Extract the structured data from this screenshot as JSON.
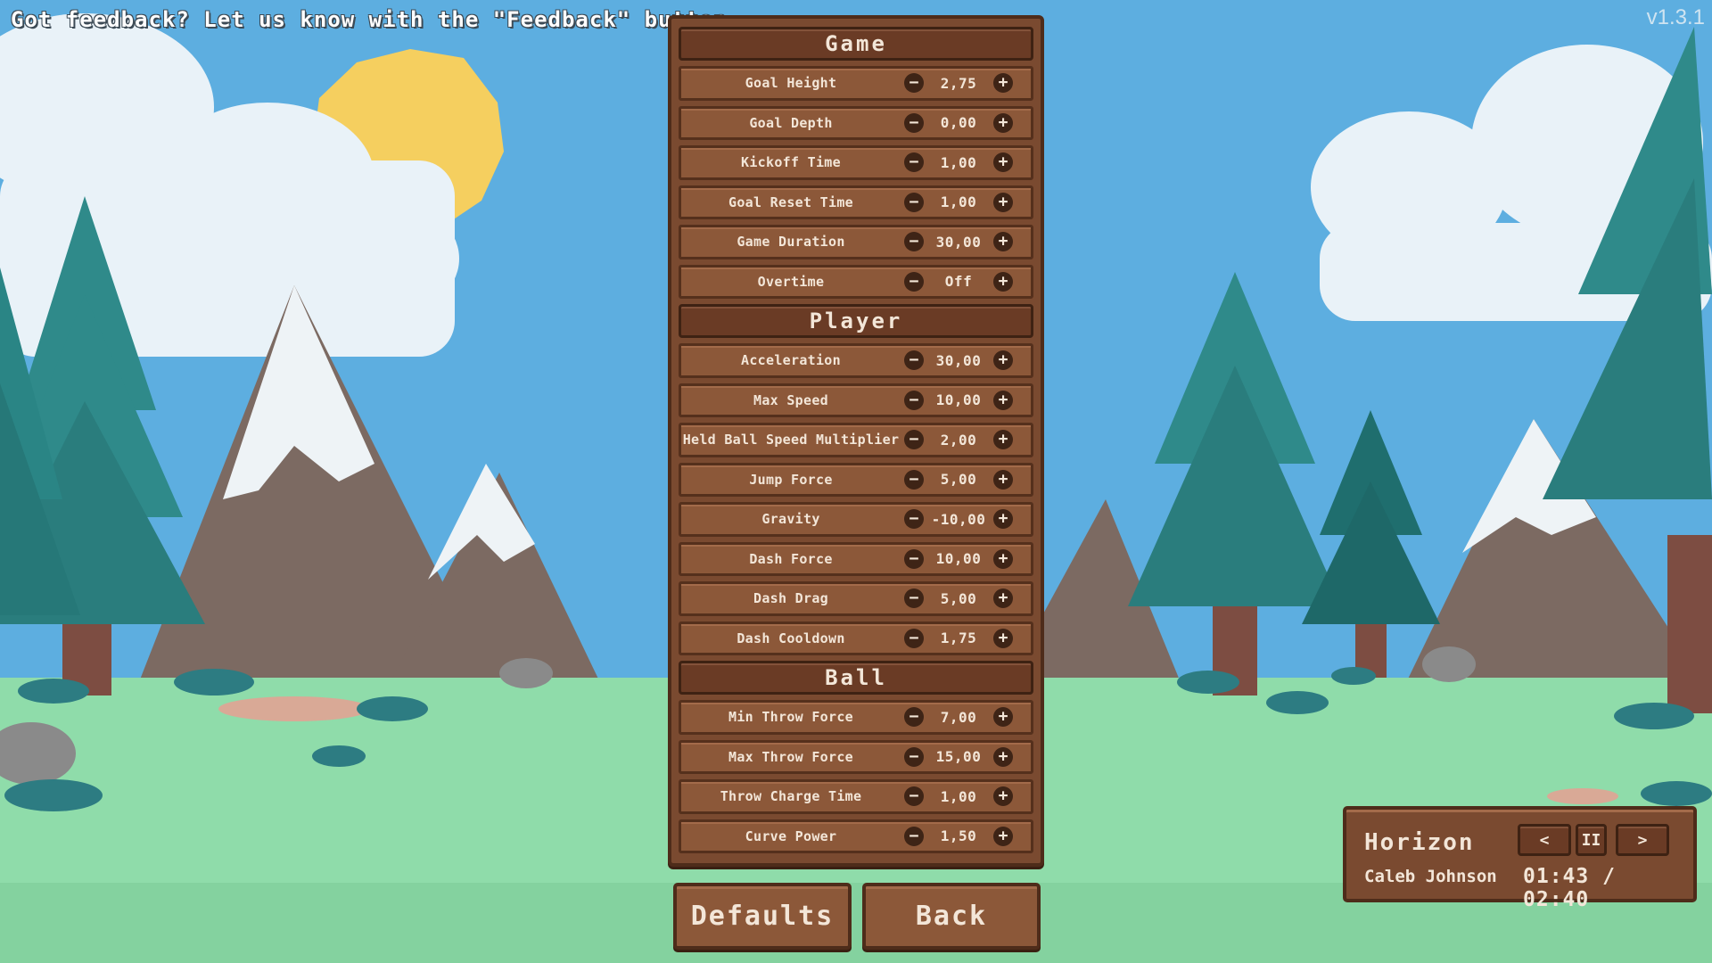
{
  "feedback_text": "Got feedback? Let us know with the \"Feedback\" button",
  "version": "v1.3.1",
  "colors": {
    "sky": "#5daee0",
    "panel": "#7a4a30",
    "panel_border": "#4e2c1a",
    "row": "#8c5839",
    "text": "#f3e6d8",
    "grass": "#8fdcaa",
    "tree": "#2f8a8a",
    "sun": "#f5cf5f"
  },
  "sections": [
    {
      "title": "Game",
      "rows": [
        {
          "label": "Goal Height",
          "value": "2,75"
        },
        {
          "label": "Goal Depth",
          "value": "0,00"
        },
        {
          "label": "Kickoff Time",
          "value": "1,00"
        },
        {
          "label": "Goal Reset Time",
          "value": "1,00"
        },
        {
          "label": "Game Duration",
          "value": "30,00"
        },
        {
          "label": "Overtime",
          "value": "Off"
        }
      ]
    },
    {
      "title": "Player",
      "rows": [
        {
          "label": "Acceleration",
          "value": "30,00"
        },
        {
          "label": "Max Speed",
          "value": "10,00"
        },
        {
          "label": "Held Ball Speed Multiplier",
          "value": "2,00"
        },
        {
          "label": "Jump Force",
          "value": "5,00"
        },
        {
          "label": "Gravity",
          "value": "-10,00"
        },
        {
          "label": "Dash Force",
          "value": "10,00"
        },
        {
          "label": "Dash Drag",
          "value": "5,00"
        },
        {
          "label": "Dash Cooldown",
          "value": "1,75"
        }
      ]
    },
    {
      "title": "Ball",
      "rows": [
        {
          "label": "Min Throw Force",
          "value": "7,00"
        },
        {
          "label": "Max Throw Force",
          "value": "15,00"
        },
        {
          "label": "Throw Charge Time",
          "value": "1,00"
        },
        {
          "label": "Curve Power",
          "value": "1,50"
        }
      ]
    }
  ],
  "controls": {
    "minus_icon": "minus-icon",
    "plus_icon": "plus-icon",
    "minus_glyph": "−",
    "plus_glyph": "+"
  },
  "buttons": {
    "defaults": "Defaults",
    "back": "Back"
  },
  "music": {
    "track": "Horizon",
    "artist": "Caleb Johnson",
    "time": "01:43 / 02:40",
    "prev_glyph": "<",
    "pause_glyph": "II",
    "next_glyph": ">"
  }
}
